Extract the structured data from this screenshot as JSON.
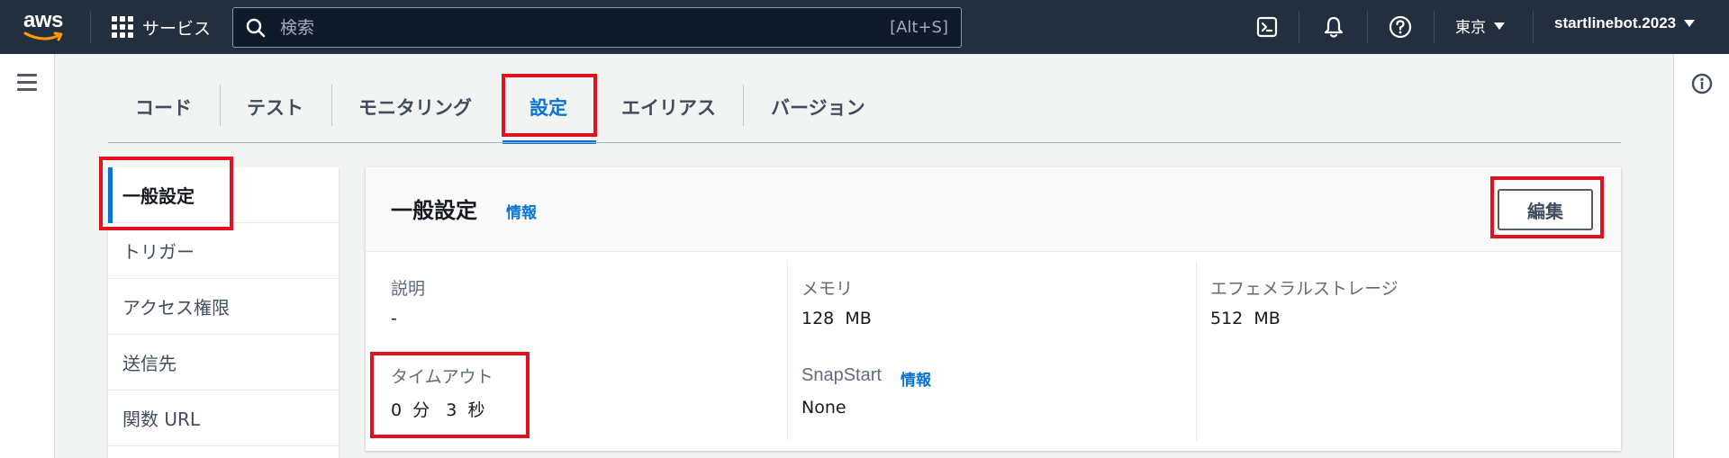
{
  "topnav": {
    "logo_text": "aws",
    "services_label": "サービス",
    "search_placeholder": "検索",
    "search_shortcut": "[Alt+S]",
    "icons": [
      "cloudshell-icon",
      "bell-icon",
      "help-icon"
    ],
    "region_label": "東京",
    "account_label": "startlinebot.2023"
  },
  "tabs": [
    {
      "label": "コード",
      "active": false
    },
    {
      "label": "テスト",
      "active": false
    },
    {
      "label": "モニタリング",
      "active": false
    },
    {
      "label": "設定",
      "active": true
    },
    {
      "label": "エイリアス",
      "active": false
    },
    {
      "label": "バージョン",
      "active": false
    }
  ],
  "sidenav": {
    "items": [
      {
        "label": "一般設定",
        "active": true
      },
      {
        "label": "トリガー",
        "active": false
      },
      {
        "label": "アクセス権限",
        "active": false
      },
      {
        "label": "送信先",
        "active": false
      },
      {
        "label": "関数 URL",
        "active": false
      }
    ]
  },
  "panel": {
    "title": "一般設定",
    "info_link": "情報",
    "edit_button": "編集",
    "fields": {
      "description": {
        "label": "説明",
        "value": "-"
      },
      "memory": {
        "label": "メモリ",
        "value": "128  MB"
      },
      "ephemeral_storage": {
        "label": "エフェメラルストレージ",
        "value": "512  MB"
      },
      "timeout": {
        "label": "タイムアウト",
        "value": "0  分   3  秒"
      },
      "snapstart": {
        "label": "SnapStart",
        "info_link": "情報",
        "value": "None"
      }
    }
  },
  "colors": {
    "nav_bg": "#232f3e",
    "accent_blue": "#0972d3",
    "highlight_red": "#e0121e",
    "aws_orange": "#ff9900"
  }
}
